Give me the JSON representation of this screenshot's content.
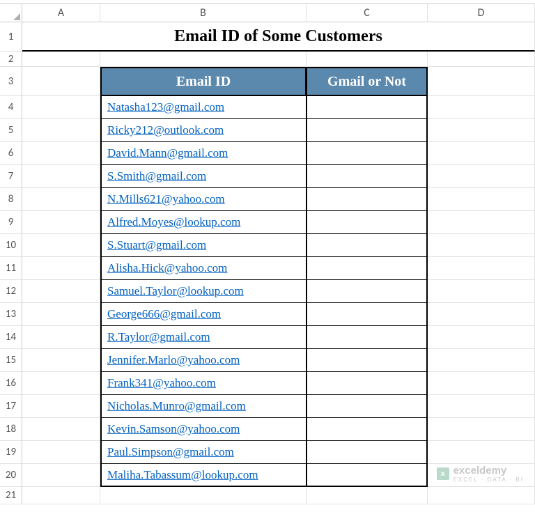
{
  "columns": [
    "A",
    "B",
    "C",
    "D"
  ],
  "rows": [
    "1",
    "2",
    "3",
    "4",
    "5",
    "6",
    "7",
    "8",
    "9",
    "10",
    "11",
    "12",
    "13",
    "14",
    "15",
    "16",
    "17",
    "18",
    "19",
    "20",
    "21"
  ],
  "title": "Email ID of Some Customers",
  "headers": {
    "email": "Email ID",
    "gmail": "Gmail or Not"
  },
  "data": [
    {
      "email": "Natasha123@gmail.com",
      "gmail": ""
    },
    {
      "email": "Ricky212@outlook.com",
      "gmail": ""
    },
    {
      "email": "David.Mann@gmail.com",
      "gmail": ""
    },
    {
      "email": "S.Smith@gmail.com",
      "gmail": ""
    },
    {
      "email": "N.Mills621@yahoo.com",
      "gmail": ""
    },
    {
      "email": "Alfred.Moyes@lookup.com",
      "gmail": ""
    },
    {
      "email": "S.Stuart@gmail.com",
      "gmail": ""
    },
    {
      "email": "Alisha.Hick@yahoo.com",
      "gmail": ""
    },
    {
      "email": "Samuel.Taylor@lookup.com",
      "gmail": ""
    },
    {
      "email": "George666@gmail.com",
      "gmail": ""
    },
    {
      "email": "R.Taylor@gmail.com",
      "gmail": ""
    },
    {
      "email": "Jennifer.Marlo@yahoo.com",
      "gmail": ""
    },
    {
      "email": "Frank341@yahoo.com",
      "gmail": ""
    },
    {
      "email": "Nicholas.Munro@gmail.com",
      "gmail": ""
    },
    {
      "email": "Kevin.Samson@yahoo.com",
      "gmail": ""
    },
    {
      "email": "Paul.Simpson@gmail.com",
      "gmail": ""
    },
    {
      "email": "Maliha.Tabassum@lookup.com",
      "gmail": ""
    }
  ],
  "watermark": {
    "brand": "exceldemy",
    "tag": "EXCEL · DATA · BI",
    "logo": "x"
  }
}
